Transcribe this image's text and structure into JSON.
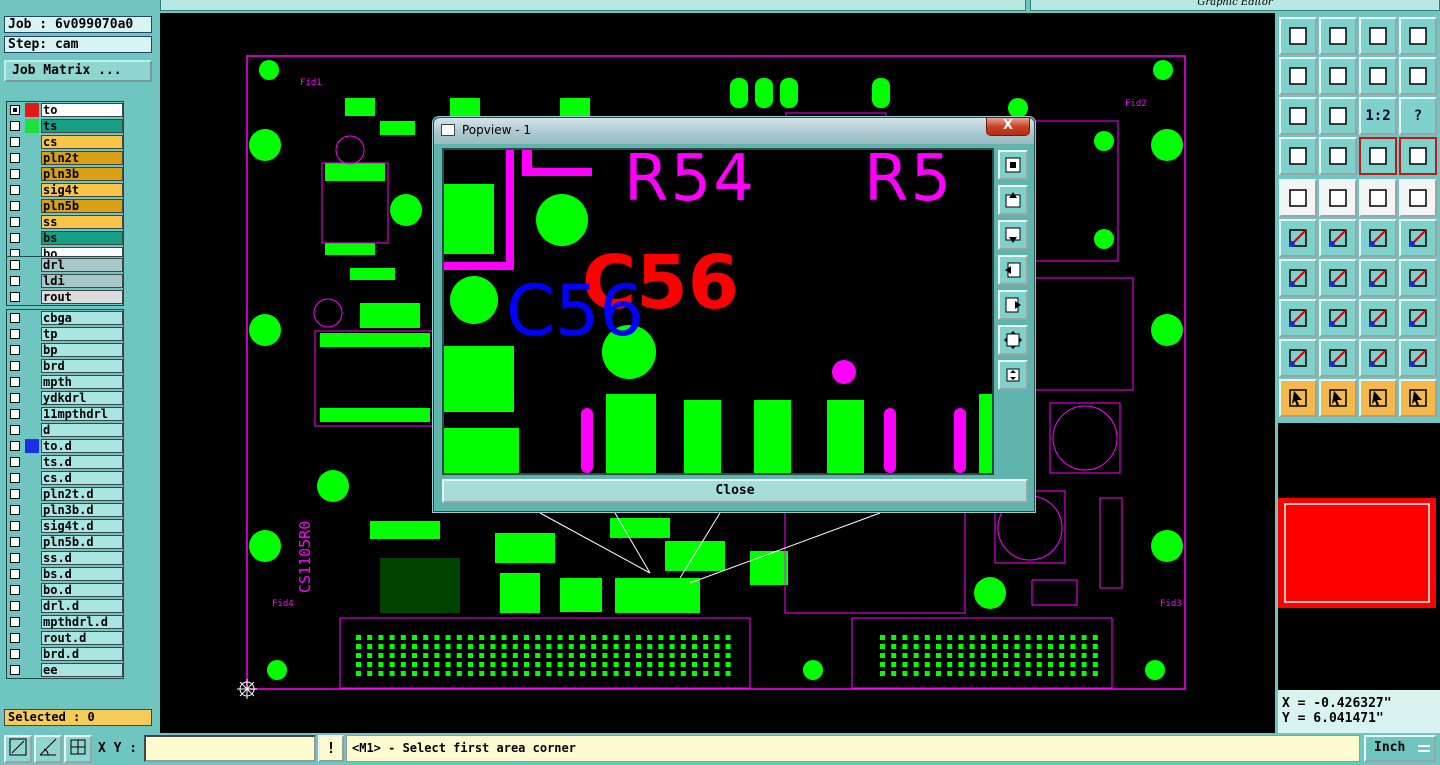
{
  "top": {
    "right_title": "Graphic Editor"
  },
  "left": {
    "job": "Job : 6v099070a0",
    "step": "Step: cam",
    "job_matrix": "Job Matrix ...",
    "selected": "Selected : 0",
    "groups": [
      {
        "layers": [
          {
            "name": "to",
            "color": "#ffffff",
            "checked": true,
            "swatch": "#e01818"
          },
          {
            "name": "ts",
            "color": "#15a085",
            "checked": false,
            "swatch": "#1ee03c"
          },
          {
            "name": "cs",
            "color": "#f7c646",
            "checked": false,
            "swatch": ""
          },
          {
            "name": "pln2t",
            "color": "#d8a015",
            "checked": false,
            "swatch": ""
          },
          {
            "name": "pln3b",
            "color": "#d8a015",
            "checked": false,
            "swatch": ""
          },
          {
            "name": "sig4t",
            "color": "#f7c646",
            "checked": false,
            "swatch": ""
          },
          {
            "name": "pln5b",
            "color": "#d8a015",
            "checked": false,
            "swatch": ""
          },
          {
            "name": "ss",
            "color": "#f7c646",
            "checked": false,
            "swatch": ""
          },
          {
            "name": "bs",
            "color": "#15a085",
            "checked": false,
            "swatch": ""
          },
          {
            "name": "bo",
            "color": "#ffffff",
            "checked": false,
            "swatch": ""
          }
        ]
      },
      {
        "layers": [
          {
            "name": "drl",
            "color": "#a7c8c8",
            "checked": false,
            "swatch": ""
          },
          {
            "name": "ldi",
            "color": "#a7c8c8",
            "checked": false,
            "swatch": ""
          },
          {
            "name": "rout",
            "color": "#dcdcdc",
            "checked": false,
            "swatch": ""
          }
        ]
      },
      {
        "layers": [
          {
            "name": "cbga",
            "color": "#a9e6e2",
            "checked": false,
            "swatch": ""
          },
          {
            "name": "tp",
            "color": "#a9e6e2",
            "checked": false,
            "swatch": ""
          },
          {
            "name": "bp",
            "color": "#a9e6e2",
            "checked": false,
            "swatch": ""
          },
          {
            "name": "brd",
            "color": "#a9e6e2",
            "checked": false,
            "swatch": ""
          },
          {
            "name": "mpth",
            "color": "#a9e6e2",
            "checked": false,
            "swatch": ""
          },
          {
            "name": "ydkdrl",
            "color": "#a9e6e2",
            "checked": false,
            "swatch": ""
          },
          {
            "name": "11mpthdrl",
            "color": "#a9e6e2",
            "checked": false,
            "swatch": ""
          },
          {
            "name": "d",
            "color": "#a9e6e2",
            "checked": false,
            "swatch": ""
          },
          {
            "name": "to.d",
            "color": "#a9e6e2",
            "checked": false,
            "swatch": "#1c2ee8"
          },
          {
            "name": "ts.d",
            "color": "#a9e6e2",
            "checked": false,
            "swatch": ""
          },
          {
            "name": "cs.d",
            "color": "#a9e6e2",
            "checked": false,
            "swatch": ""
          },
          {
            "name": "pln2t.d",
            "color": "#a9e6e2",
            "checked": false,
            "swatch": ""
          },
          {
            "name": "pln3b.d",
            "color": "#a9e6e2",
            "checked": false,
            "swatch": ""
          },
          {
            "name": "sig4t.d",
            "color": "#a9e6e2",
            "checked": false,
            "swatch": ""
          },
          {
            "name": "pln5b.d",
            "color": "#a9e6e2",
            "checked": false,
            "swatch": ""
          },
          {
            "name": "ss.d",
            "color": "#a9e6e2",
            "checked": false,
            "swatch": ""
          },
          {
            "name": "bs.d",
            "color": "#a9e6e2",
            "checked": false,
            "swatch": ""
          },
          {
            "name": "bo.d",
            "color": "#a9e6e2",
            "checked": false,
            "swatch": ""
          },
          {
            "name": "drl.d",
            "color": "#a9e6e2",
            "checked": false,
            "swatch": ""
          },
          {
            "name": "mpthdrl.d",
            "color": "#a9e6e2",
            "checked": false,
            "swatch": ""
          },
          {
            "name": "rout.d",
            "color": "#a9e6e2",
            "checked": false,
            "swatch": ""
          },
          {
            "name": "brd.d",
            "color": "#a9e6e2",
            "checked": false,
            "swatch": ""
          },
          {
            "name": "ee",
            "color": "#a9e6e2",
            "checked": false,
            "swatch": ""
          }
        ]
      }
    ]
  },
  "popup": {
    "title": "Popview - 1",
    "close_x": "X",
    "close_label": "Close",
    "labels": {
      "r54": "R54",
      "r5": "R5",
      "c56_red": "C56",
      "c56_blue": "C56"
    }
  },
  "board": {
    "silk": [
      "Fid1",
      "Fid2",
      "Fid3",
      "Fid4",
      "CS1105R0"
    ]
  },
  "right": {
    "scale_label": "1:2",
    "help_label": "?",
    "coord_x": "X = -0.426327\"",
    "coord_y": "Y = 6.041471\""
  },
  "bottom": {
    "xy_label": "X Y :",
    "xy_value": "",
    "bang": "!",
    "message": "<M1> - Select first area corner",
    "units": "Inch"
  },
  "colors": {
    "panel": "#6fc6c0",
    "pad": "#00ff00",
    "silk": "#ff00ff",
    "accent_red": "#ff0000",
    "accent_blue": "#0000ff"
  }
}
